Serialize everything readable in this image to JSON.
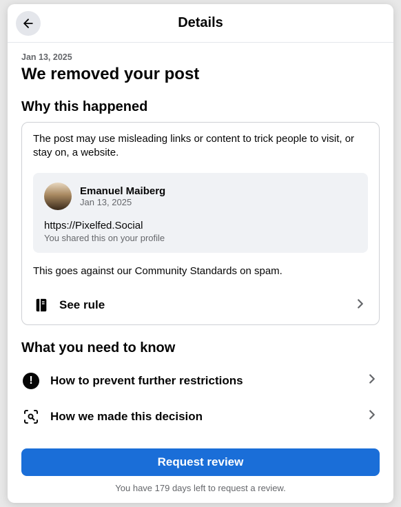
{
  "header": {
    "title": "Details"
  },
  "date": "Jan 13, 2025",
  "main_title": "We removed your post",
  "why": {
    "heading": "Why this happened",
    "explanation": "The post may use misleading links or content to trick people to visit, or stay on, a website.",
    "post": {
      "author": "Emanuel Maiberg",
      "date": "Jan 13, 2025",
      "url": "https://Pixelfed.Social",
      "share_note": "You shared this on your profile"
    },
    "standards_text": "This goes against our Community Standards on spam.",
    "see_rule_label": "See rule"
  },
  "know": {
    "heading": "What you need to know",
    "items": [
      {
        "label": "How to prevent further restrictions"
      },
      {
        "label": "How we made this decision"
      }
    ]
  },
  "footer": {
    "button": "Request review",
    "note": "You have 179 days left to request a review."
  }
}
